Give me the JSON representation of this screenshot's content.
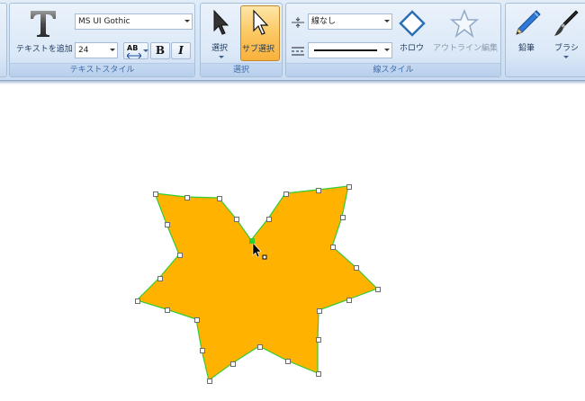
{
  "ribbon": {
    "text_style": {
      "caption": "テキストスタイル",
      "add_text_label": "テキストを追加",
      "font_name": "MS UI Gothic",
      "font_size": "24",
      "spacing_label": "AB",
      "bold_label": "B",
      "italic_label": "I"
    },
    "select": {
      "caption": "選択",
      "select_label": "選択",
      "sub_select_label": "サブ選択"
    },
    "line_style": {
      "caption": "線スタイル",
      "line_type_value": "線なし",
      "hollow_label": "ホロウ",
      "outline_edit_label": "アウトライン編集"
    },
    "tools": {
      "pencil_label": "鉛筆",
      "brush_label": "ブラシ"
    }
  },
  "canvas": {
    "shape": "star",
    "fill_color": "#FFB200",
    "outline_color": "#33CC33"
  },
  "colors": {
    "ribbon_bg": "#D5E4F5",
    "active_button": "#F9B13D",
    "caption_text": "#3E6AAA"
  }
}
